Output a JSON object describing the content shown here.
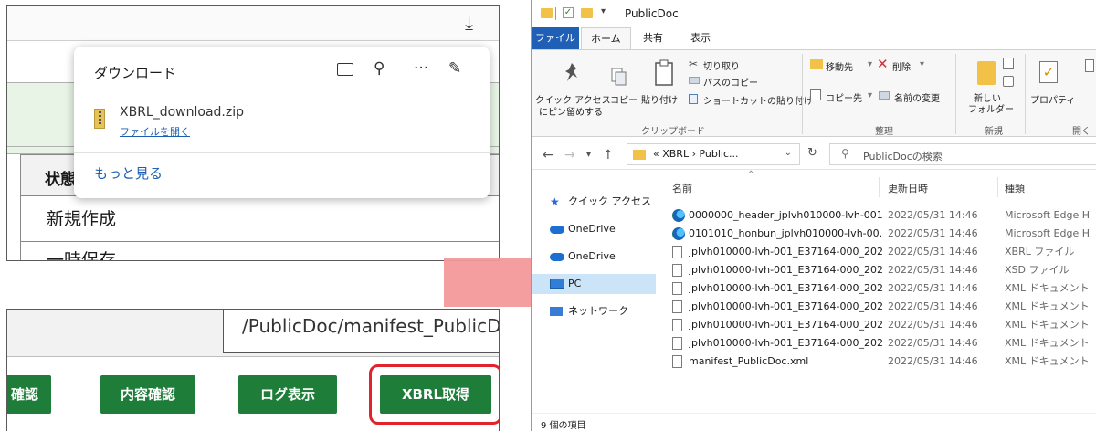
{
  "browser": {
    "download_panel": {
      "title": "ダウンロード",
      "file_name": "XBRL_download.zip",
      "open_file_label": "ファイルを開く",
      "see_more_label": "もっと見る",
      "more_glyph": "···"
    },
    "table": {
      "header_label": "状態",
      "rows": [
        "新規作成",
        "一時保存"
      ]
    }
  },
  "form": {
    "manifest_path": "/PublicDoc/manifest_PublicDoc.",
    "buttons": {
      "check": "確認",
      "content_check": "内容確認",
      "log": "ログ表示",
      "xbrl": "XBRL取得"
    },
    "highlight_color": "#e0232c",
    "button_color": "#1f7d3a"
  },
  "explorer": {
    "title": "PublicDoc",
    "tabs": [
      "ファイル",
      "ホーム",
      "共有",
      "表示"
    ],
    "ribbon": {
      "pin_label_1": "クイック アクセス",
      "pin_label_2": "にピン留めする",
      "copy": "コピー",
      "paste": "貼り付け",
      "cut": "切り取り",
      "copy_path": "パスのコピー",
      "paste_shortcut": "ショートカットの貼り付け",
      "clipboard_group": "クリップボード",
      "move_to": "移動先",
      "copy_to": "コピー先",
      "delete": "削除",
      "rename": "名前の変更",
      "organize_group": "整理",
      "new_folder_1": "新しい",
      "new_folder_2": "フォルダー",
      "new_group": "新規",
      "properties": "プロパティ",
      "open_group": "開く"
    },
    "address": {
      "path": "« XBRL › Public...",
      "search_placeholder": "PublicDocの検索"
    },
    "nav": {
      "quick_access": "クイック アクセス",
      "onedrive_1": "OneDrive",
      "onedrive_2": "OneDrive",
      "pc": "PC",
      "network": "ネットワーク"
    },
    "columns": {
      "name": "名前",
      "modified": "更新日時",
      "type": "種類"
    },
    "files": [
      {
        "name": "0000000_header_jplvh010000-lvh-001...",
        "date": "2022/05/31 14:46",
        "type": "Microsoft Edge H",
        "icon": "edge"
      },
      {
        "name": "0101010_honbun_jplvh010000-lvh-00...",
        "date": "2022/05/31 14:46",
        "type": "Microsoft Edge H",
        "icon": "edge"
      },
      {
        "name": "jplvh010000-lvh-001_E37164-000_202...",
        "date": "2022/05/31 14:46",
        "type": "XBRL ファイル",
        "icon": "doc"
      },
      {
        "name": "jplvh010000-lvh-001_E37164-000_202...",
        "date": "2022/05/31 14:46",
        "type": "XSD ファイル",
        "icon": "doc"
      },
      {
        "name": "jplvh010000-lvh-001_E37164-000_202...",
        "date": "2022/05/31 14:46",
        "type": "XML ドキュメント",
        "icon": "doc"
      },
      {
        "name": "jplvh010000-lvh-001_E37164-000_202...",
        "date": "2022/05/31 14:46",
        "type": "XML ドキュメント",
        "icon": "doc"
      },
      {
        "name": "jplvh010000-lvh-001_E37164-000_202...",
        "date": "2022/05/31 14:46",
        "type": "XML ドキュメント",
        "icon": "doc"
      },
      {
        "name": "jplvh010000-lvh-001_E37164-000_202...",
        "date": "2022/05/31 14:46",
        "type": "XML ドキュメント",
        "icon": "doc"
      },
      {
        "name": "manifest_PublicDoc.xml",
        "date": "2022/05/31 14:46",
        "type": "XML ドキュメント",
        "icon": "doc"
      }
    ],
    "status": "9 個の項目"
  }
}
